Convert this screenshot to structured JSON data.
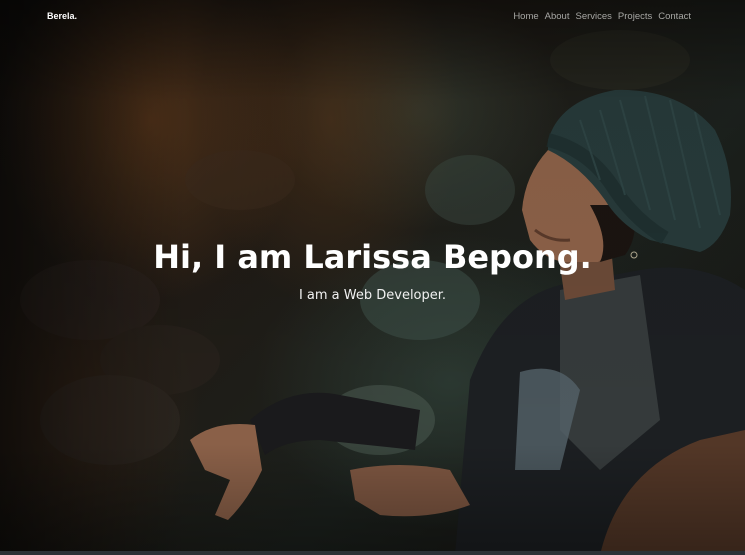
{
  "brand": "Berela.",
  "nav": {
    "items": [
      {
        "label": "Home"
      },
      {
        "label": "About"
      },
      {
        "label": "Services"
      },
      {
        "label": "Projects"
      },
      {
        "label": "Contact"
      }
    ]
  },
  "hero": {
    "title": "Hi, I am Larissa Bepong.",
    "subtitle": "I am a Web Developer."
  },
  "colors": {
    "text_primary": "#ffffff",
    "nav_text": "#a7a7a4",
    "beanie": "#2a3d3c",
    "background_dark": "#0c0f0d"
  }
}
